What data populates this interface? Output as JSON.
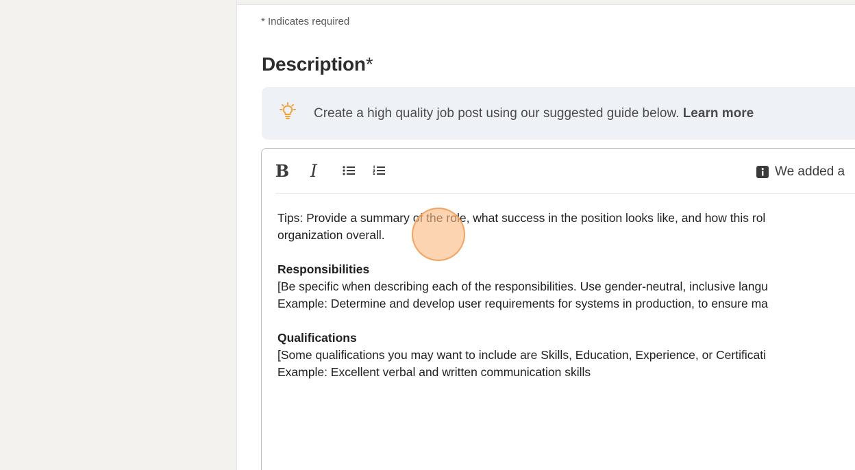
{
  "form": {
    "required_note": "* Indicates required",
    "section_title": "Description",
    "required_marker": "*"
  },
  "tip_banner": {
    "icon": "lightbulb-icon",
    "text": "Create a high quality job post using our suggested guide below. ",
    "link_label": "Learn more"
  },
  "editor": {
    "toolbar": {
      "bold_label": "B",
      "italic_label": "I",
      "bullet_icon": "bullet-list-icon",
      "numbered_icon": "numbered-list-icon",
      "notice_icon": "info-icon",
      "notice_text": "We added a"
    },
    "body": {
      "tips_line_1": "Tips: Provide a summary of the role, what success in the position looks like, and how this rol",
      "tips_line_2": "organization overall.",
      "responsibilities_heading": "Responsibilities",
      "responsibilities_line_1": "[Be specific when describing each of the responsibilities. Use gender-neutral, inclusive langu",
      "responsibilities_line_2": "Example: Determine and develop user requirements for systems in production, to ensure ma",
      "qualifications_heading": "Qualifications",
      "qualifications_line_1": "[Some qualifications you may want to include are Skills, Education, Experience, or Certificati",
      "qualifications_line_2": "Example: Excellent verbal and written communication skills"
    }
  },
  "colors": {
    "gutter": "#f3f2ef",
    "banner_bg": "#eef2f7",
    "bulb": "#f0a23b",
    "click_indicator": "#f6a25f"
  }
}
